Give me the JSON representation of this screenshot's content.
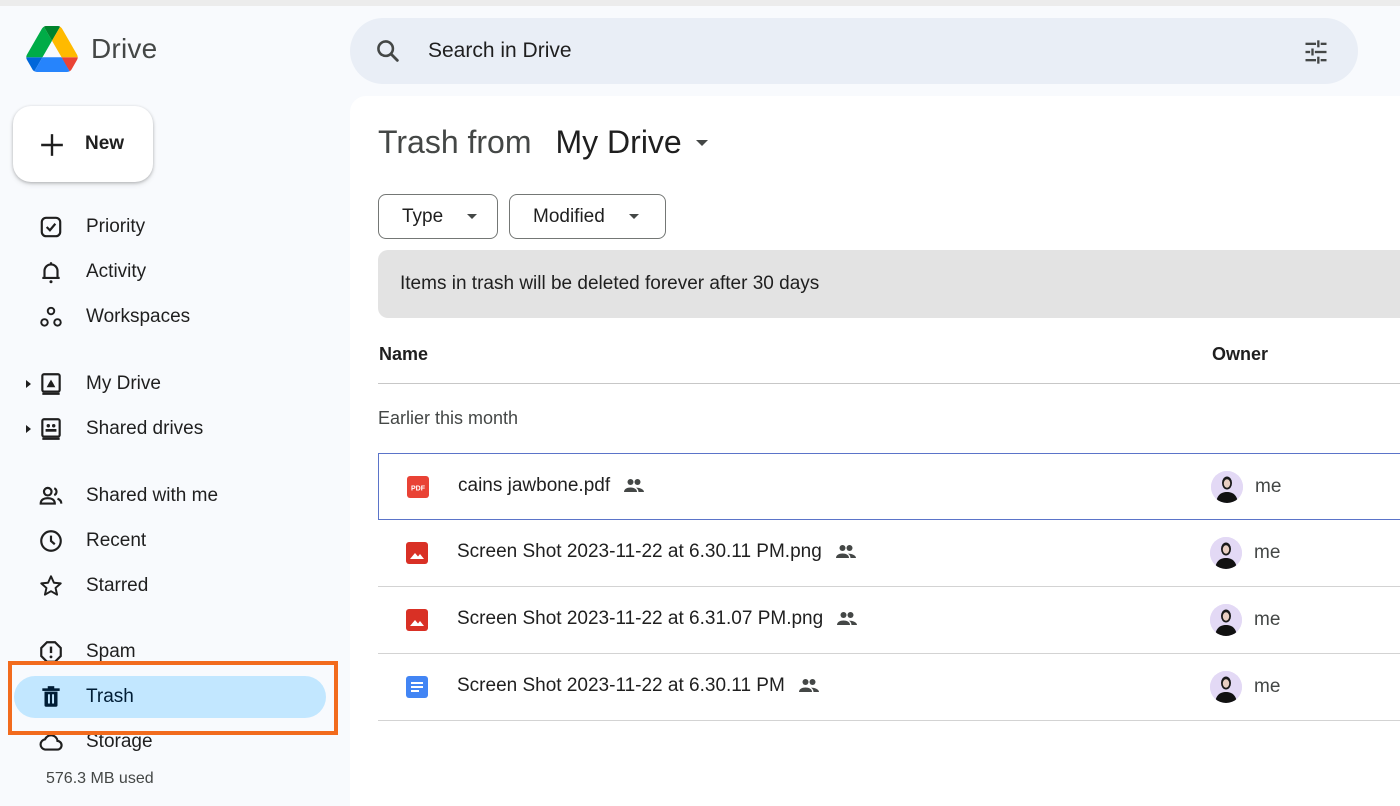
{
  "app": {
    "name": "Drive",
    "logo_icon": "google-drive-logo"
  },
  "search": {
    "placeholder": "Search in Drive",
    "search_icon": "search-icon",
    "filter_icon": "tune-icon"
  },
  "new_button": {
    "label": "New",
    "icon": "plus-icon"
  },
  "sidebar": {
    "items": [
      {
        "label": "Priority",
        "icon": "priority-check-icon"
      },
      {
        "label": "Activity",
        "icon": "bell-icon"
      },
      {
        "label": "Workspaces",
        "icon": "workspaces-icon"
      },
      {
        "label": "My Drive",
        "icon": "my-drive-icon",
        "expandable": true
      },
      {
        "label": "Shared drives",
        "icon": "shared-drives-icon",
        "expandable": true
      },
      {
        "label": "Shared with me",
        "icon": "people-icon"
      },
      {
        "label": "Recent",
        "icon": "clock-icon"
      },
      {
        "label": "Starred",
        "icon": "star-icon"
      },
      {
        "label": "Spam",
        "icon": "spam-icon"
      },
      {
        "label": "Trash",
        "icon": "trash-icon",
        "active": true
      },
      {
        "label": "Storage",
        "icon": "cloud-icon"
      }
    ],
    "storage_used": "576.3 MB used",
    "highlight_color": "#f26b1d"
  },
  "main": {
    "title_prefix": "Trash from",
    "title_location": "My Drive",
    "filters": [
      {
        "label": "Type"
      },
      {
        "label": "Modified"
      }
    ],
    "banner": "Items in trash will be deleted forever after 30 days",
    "columns": {
      "name": "Name",
      "owner": "Owner"
    },
    "group_label": "Earlier this month",
    "files": [
      {
        "name": "cains jawbone.pdf",
        "type": "pdf",
        "icon": "pdf-file-icon",
        "shared": true,
        "owner": "me",
        "selected": true
      },
      {
        "name": "Screen Shot 2023-11-22 at 6.30.11 PM.png",
        "type": "image",
        "icon": "image-file-icon",
        "shared": true,
        "owner": "me"
      },
      {
        "name": "Screen Shot 2023-11-22 at 6.31.07 PM.png",
        "type": "image",
        "icon": "image-file-icon",
        "shared": true,
        "owner": "me"
      },
      {
        "name": "Screen Shot 2023-11-22 at 6.30.11 PM",
        "type": "doc",
        "icon": "docs-file-icon",
        "shared": true,
        "owner": "me"
      }
    ]
  },
  "colors": {
    "active_nav": "#c2e7ff",
    "search_bg": "#e9eef6",
    "pdf_red": "#e94235",
    "image_red": "#d93025",
    "docs_blue": "#4285f4",
    "selected_border": "#5b74c9"
  }
}
